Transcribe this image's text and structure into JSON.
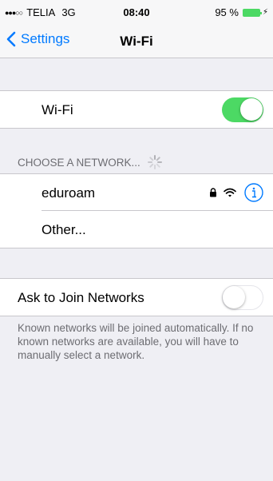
{
  "status_bar": {
    "signal_dots": "●●●○○",
    "carrier": "TELIA",
    "network": "3G",
    "time": "08:40",
    "battery_percent": "95 %"
  },
  "nav": {
    "back_label": "Settings",
    "title": "Wi-Fi"
  },
  "wifi": {
    "label": "Wi-Fi",
    "enabled": true
  },
  "networks": {
    "header": "CHOOSE A NETWORK...",
    "items": [
      {
        "name": "eduroam",
        "secured": true,
        "icons": [
          "lock-icon",
          "wifi-icon",
          "info-icon"
        ]
      },
      {
        "name": "Other..."
      }
    ]
  },
  "ask_to_join": {
    "label": "Ask to Join Networks",
    "enabled": false
  },
  "footer": "Known networks will be joined automatically. If no known networks are available, you will have to manually select a network.",
  "colors": {
    "accent": "#007aff",
    "toggle_on": "#4cd964",
    "background": "#efeff4"
  }
}
